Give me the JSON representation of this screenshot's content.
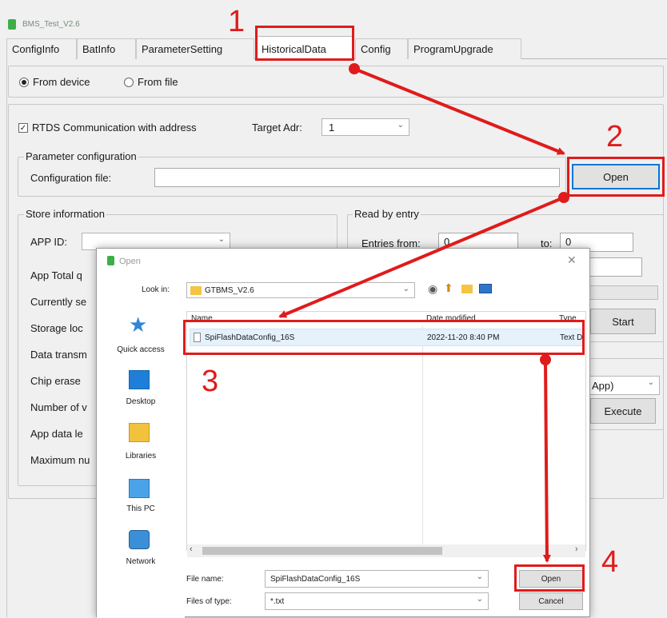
{
  "window": {
    "title": "BMS_Test_V2.6"
  },
  "tabs": [
    {
      "label": "ConfigInfo"
    },
    {
      "label": "BatInfo"
    },
    {
      "label": "ParameterSetting"
    },
    {
      "label": "HistoricalData"
    },
    {
      "label": "Config"
    },
    {
      "label": "ProgramUpgrade"
    }
  ],
  "source": {
    "device_label": "From device",
    "file_label": "From file",
    "selected": "From device"
  },
  "rtds": {
    "label": "RTDS Communication with address",
    "checked": true,
    "target_label": "Target Adr:",
    "target_value": "1"
  },
  "param_config": {
    "group_label": "Parameter configuration",
    "file_label": "Configuration file:",
    "file_value": "",
    "open_label": "Open"
  },
  "store_info": {
    "group_label": "Store information",
    "app_id_label": "APP ID:",
    "rows": [
      "App Total q",
      "Currently se",
      "Storage loc",
      "Data transm",
      "Chip erase",
      "Number of v",
      "App data le",
      "Maximum nu"
    ]
  },
  "read_entry": {
    "group_label": "Read by entry",
    "entries_from_label": "Entries from:",
    "from_value": "0",
    "to_label": "to:",
    "to_value": "0",
    "start_label": "Start"
  },
  "execute": {
    "combo_value": "App)",
    "button_label": "Execute"
  },
  "dialog": {
    "title": "Open",
    "lookin_label": "Look in:",
    "lookin_value": "GTBMS_V2.6",
    "columns": {
      "name": "Name",
      "date": "Date modified",
      "type": "Type"
    },
    "files": [
      {
        "name": "SpiFlashDataConfig_16S",
        "date": "2022-11-20 8:40 PM",
        "type": "Text D"
      }
    ],
    "places": [
      {
        "label": "Quick access"
      },
      {
        "label": "Desktop"
      },
      {
        "label": "Libraries"
      },
      {
        "label": "This PC"
      },
      {
        "label": "Network"
      }
    ],
    "filename_label": "File name:",
    "filename_value": "SpiFlashDataConfig_16S",
    "filetype_label": "Files of type:",
    "filetype_value": "*.txt",
    "open_label": "Open",
    "cancel_label": "Cancel"
  },
  "annotations": {
    "step1": "1",
    "step2": "2",
    "step3": "3",
    "step4": "4",
    "color": "#e01b1b"
  }
}
